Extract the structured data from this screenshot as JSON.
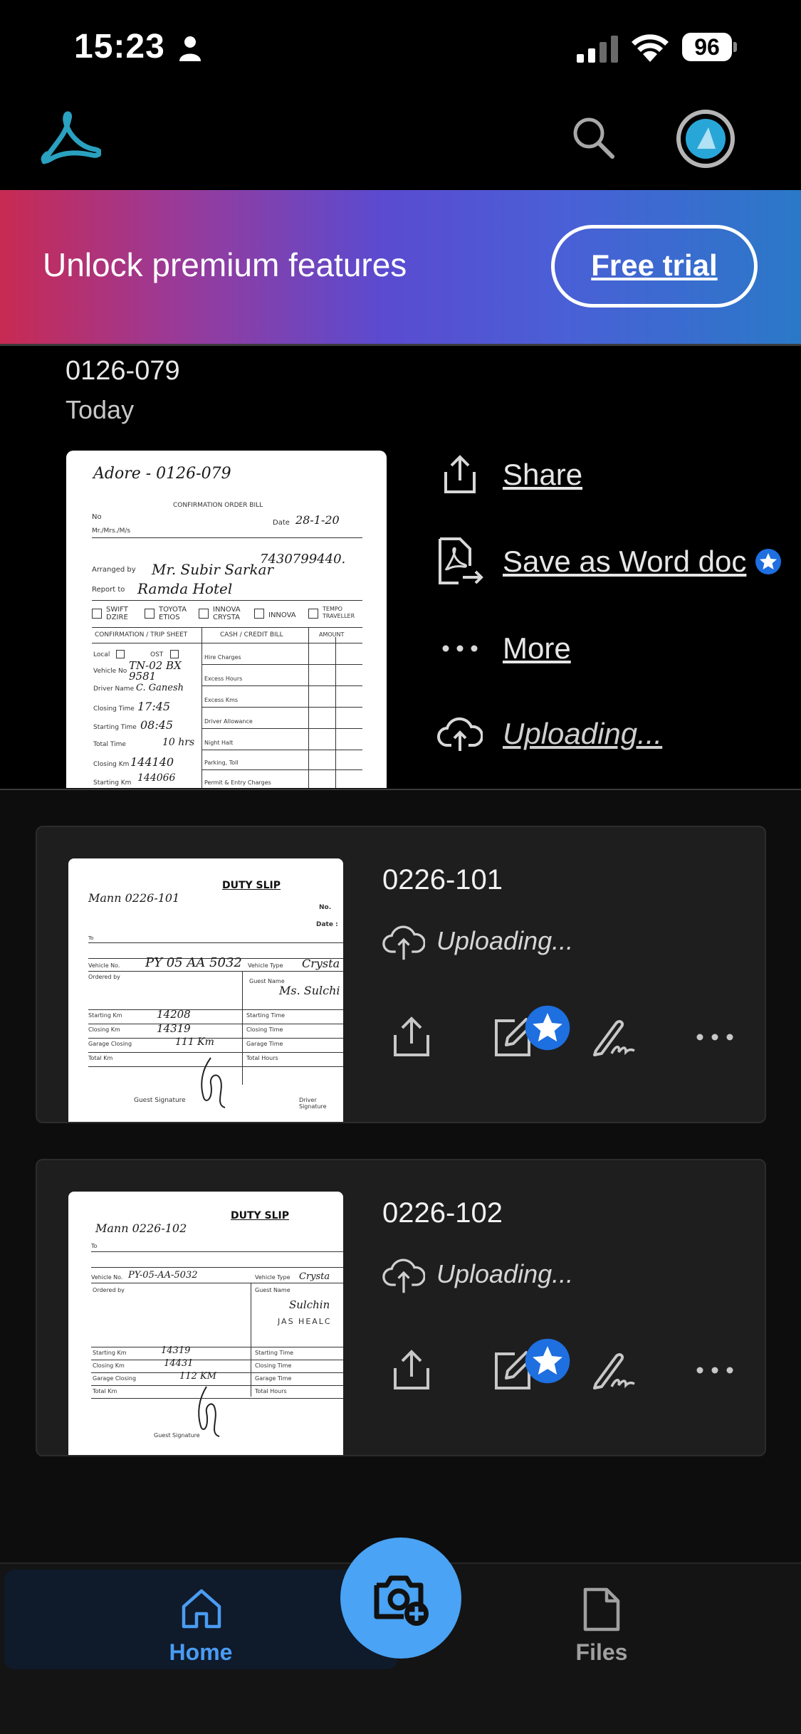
{
  "status_bar": {
    "time": "15:23",
    "battery": "96"
  },
  "banner": {
    "text": "Unlock premium features",
    "button": "Free trial"
  },
  "recent": {
    "title": "0126-079",
    "date": "Today",
    "actions": {
      "share": "Share",
      "save_word": "Save as Word doc",
      "more": "More",
      "uploading": "Uploading..."
    },
    "doc": {
      "header": "Adore - 0126-079",
      "form_title": "CONFIRMATION ORDER BILL",
      "no": "No",
      "ms_mrs": "Mr./Mrs./M/s",
      "date": "Date",
      "date_value": "28-1-20",
      "phone": "7430799440.",
      "arranged_by": "Arranged by",
      "arranged_value": "Mr. Subir Sarkar",
      "report_to": "Report to",
      "report_value": "Ramda Hotel",
      "vehicles": [
        "SWIFT DZIRE",
        "TOYOTA ETIOS",
        "INNOVA CRYSTA",
        "INNOVA",
        "TEMPO TRAVELLER"
      ],
      "trip_sheet": "CONFIRMATION / TRIP SHEET",
      "cash_bill": "CASH / CREDIT BILL",
      "amount": "AMOUNT",
      "local": "Local",
      "ost": "OST",
      "vehicle_no": "Vehicle No",
      "vehicle_value": "TN-02 BX 9581",
      "driver_name": "Driver Name",
      "driver_value": "C. Ganesh",
      "closing_time": "Closing Time",
      "closing_time_value": "17:45",
      "starting_time": "Starting Time",
      "starting_time_value": "08:45",
      "total_time": "Total Time",
      "total_time_value": "10 hrs",
      "closing_km": "Closing Km",
      "closing_km_value": "144140",
      "starting_km": "Starting Km",
      "starting_km_value": "144066",
      "charges": [
        "Hire Charges",
        "Excess Hours",
        "Excess Kms",
        "Driver Allowance",
        "Night Halt",
        "Parking, Toll",
        "Permit & Entry Charges"
      ]
    }
  },
  "files": [
    {
      "name": "0226-101",
      "status": "Uploading...",
      "doc": {
        "header": "Mann 0226-101",
        "title": "DUTY SLIP",
        "no": "No.",
        "date": "Date :",
        "to": "To",
        "vehicle_no": "Vehicle No.",
        "vehicle_value": "PY 05 AA 5032",
        "vehicle_type": "Vehicle Type",
        "vehicle_type_value": "Crysta",
        "ordered_by": "Ordered by",
        "guest_name": "Guest Name",
        "guest_value": "Ms. Sulchi",
        "rows": [
          "Starting Km",
          "Closing Km",
          "Garage Closing",
          "Total Km"
        ],
        "values": [
          "14208",
          "14319",
          "111 Km"
        ],
        "rows_right": [
          "Starting Time",
          "Closing Time",
          "Garage Time",
          "Total Hours"
        ],
        "guest_sig": "Guest Signature",
        "driver_sig": "Driver Signature"
      }
    },
    {
      "name": "0226-102",
      "status": "Uploading...",
      "doc": {
        "header": "Mann 0226-102",
        "title": "DUTY SLIP",
        "to": "To",
        "vehicle_no": "Vehicle No.",
        "vehicle_value": "PY-05-AA-5032",
        "vehicle_type": "Vehicle Type",
        "vehicle_type_value": "Crysta",
        "ordered_by": "Ordered by",
        "guest_name": "Guest Name",
        "guest_value": "Sulchin",
        "guest_sub": "JAS HEALC",
        "rows": [
          "Starting Km",
          "Closing Km",
          "Garage Closing",
          "Total Km"
        ],
        "values": [
          "14319",
          "14431",
          "112 KM"
        ],
        "rows_right": [
          "Starting Time",
          "Closing Time",
          "Garage Time",
          "Total Hours"
        ],
        "guest_sig": "Guest Signature"
      }
    }
  ],
  "nav": {
    "home": "Home",
    "files": "Files"
  },
  "colors": {
    "accent": "#4aa3f4",
    "home_active": "#4a9cf2",
    "premium_star": "#1e6fe0",
    "card_bg": "#1e1e1e"
  },
  "icons": [
    "person-icon",
    "signal-icon",
    "wifi-icon",
    "acrobat-logo",
    "search-icon",
    "share-icon",
    "save-word-icon",
    "more-icon",
    "cloud-upload-icon",
    "edit-icon",
    "sign-icon",
    "home-icon",
    "files-icon",
    "camera-plus-icon",
    "premium-star-icon"
  ]
}
